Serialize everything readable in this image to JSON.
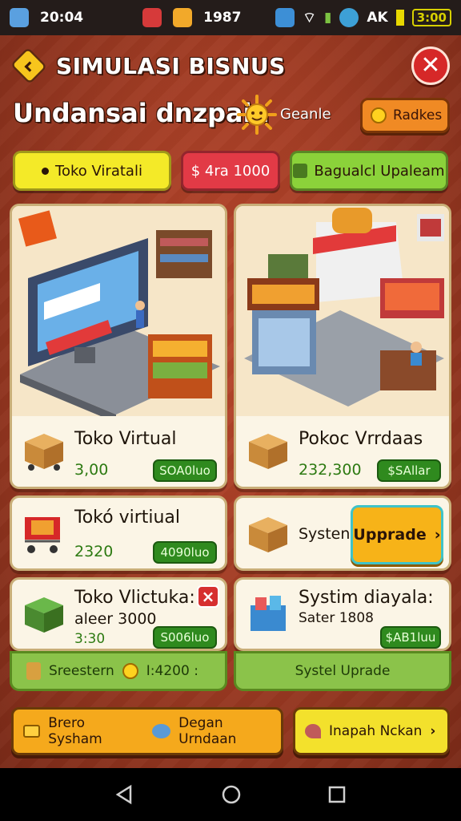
{
  "status_bar": {
    "time_left": "20:04",
    "mid_value": "1987",
    "right_label": "AK",
    "clock": "3:00"
  },
  "header": {
    "title": "SIMULASI BISNUS",
    "subtitle": "Undansai dnzpaia",
    "sun_label": "Geanle",
    "badge_label": "Radkes"
  },
  "tabs": [
    {
      "label": "Toko Viratali"
    },
    {
      "label": "$ 4ra 1000"
    },
    {
      "label": "Bagualcl Upaleam"
    }
  ],
  "cards": {
    "store_left": {
      "title": "Toko Virtual",
      "value": "3,00",
      "pill": "SOA0luo"
    },
    "store_right": {
      "title": "Pokoc Vrrdaas",
      "value": "232,300",
      "pill": "$SAllar"
    },
    "row2_left": {
      "title": "Tokó virtiual",
      "value": "2320",
      "pill": "4090luo"
    },
    "row2_right": {
      "label": "Systen",
      "upgrade": "Upprade"
    },
    "row3_left": {
      "title": "Toko Vlictuka:",
      "sub": "aleer 3000",
      "value": "3:30",
      "pill": "S006luo"
    },
    "row3_right": {
      "title": "Systim diayala:",
      "sub": "Sater 1808",
      "pill": "$AB1luu"
    }
  },
  "strips": {
    "left_text": "Sreestern",
    "left_value": "I:4200 :",
    "right_text": "Systel Uprade"
  },
  "bottom": {
    "left_a": "Brero Sysham",
    "left_b": "Degan Urndaan",
    "right": "Inapah Nckan"
  },
  "colors": {
    "accent_yellow": "#f4ea28",
    "accent_red": "#e23a46",
    "accent_green": "#8bd23a",
    "bg": "#a13c24"
  }
}
